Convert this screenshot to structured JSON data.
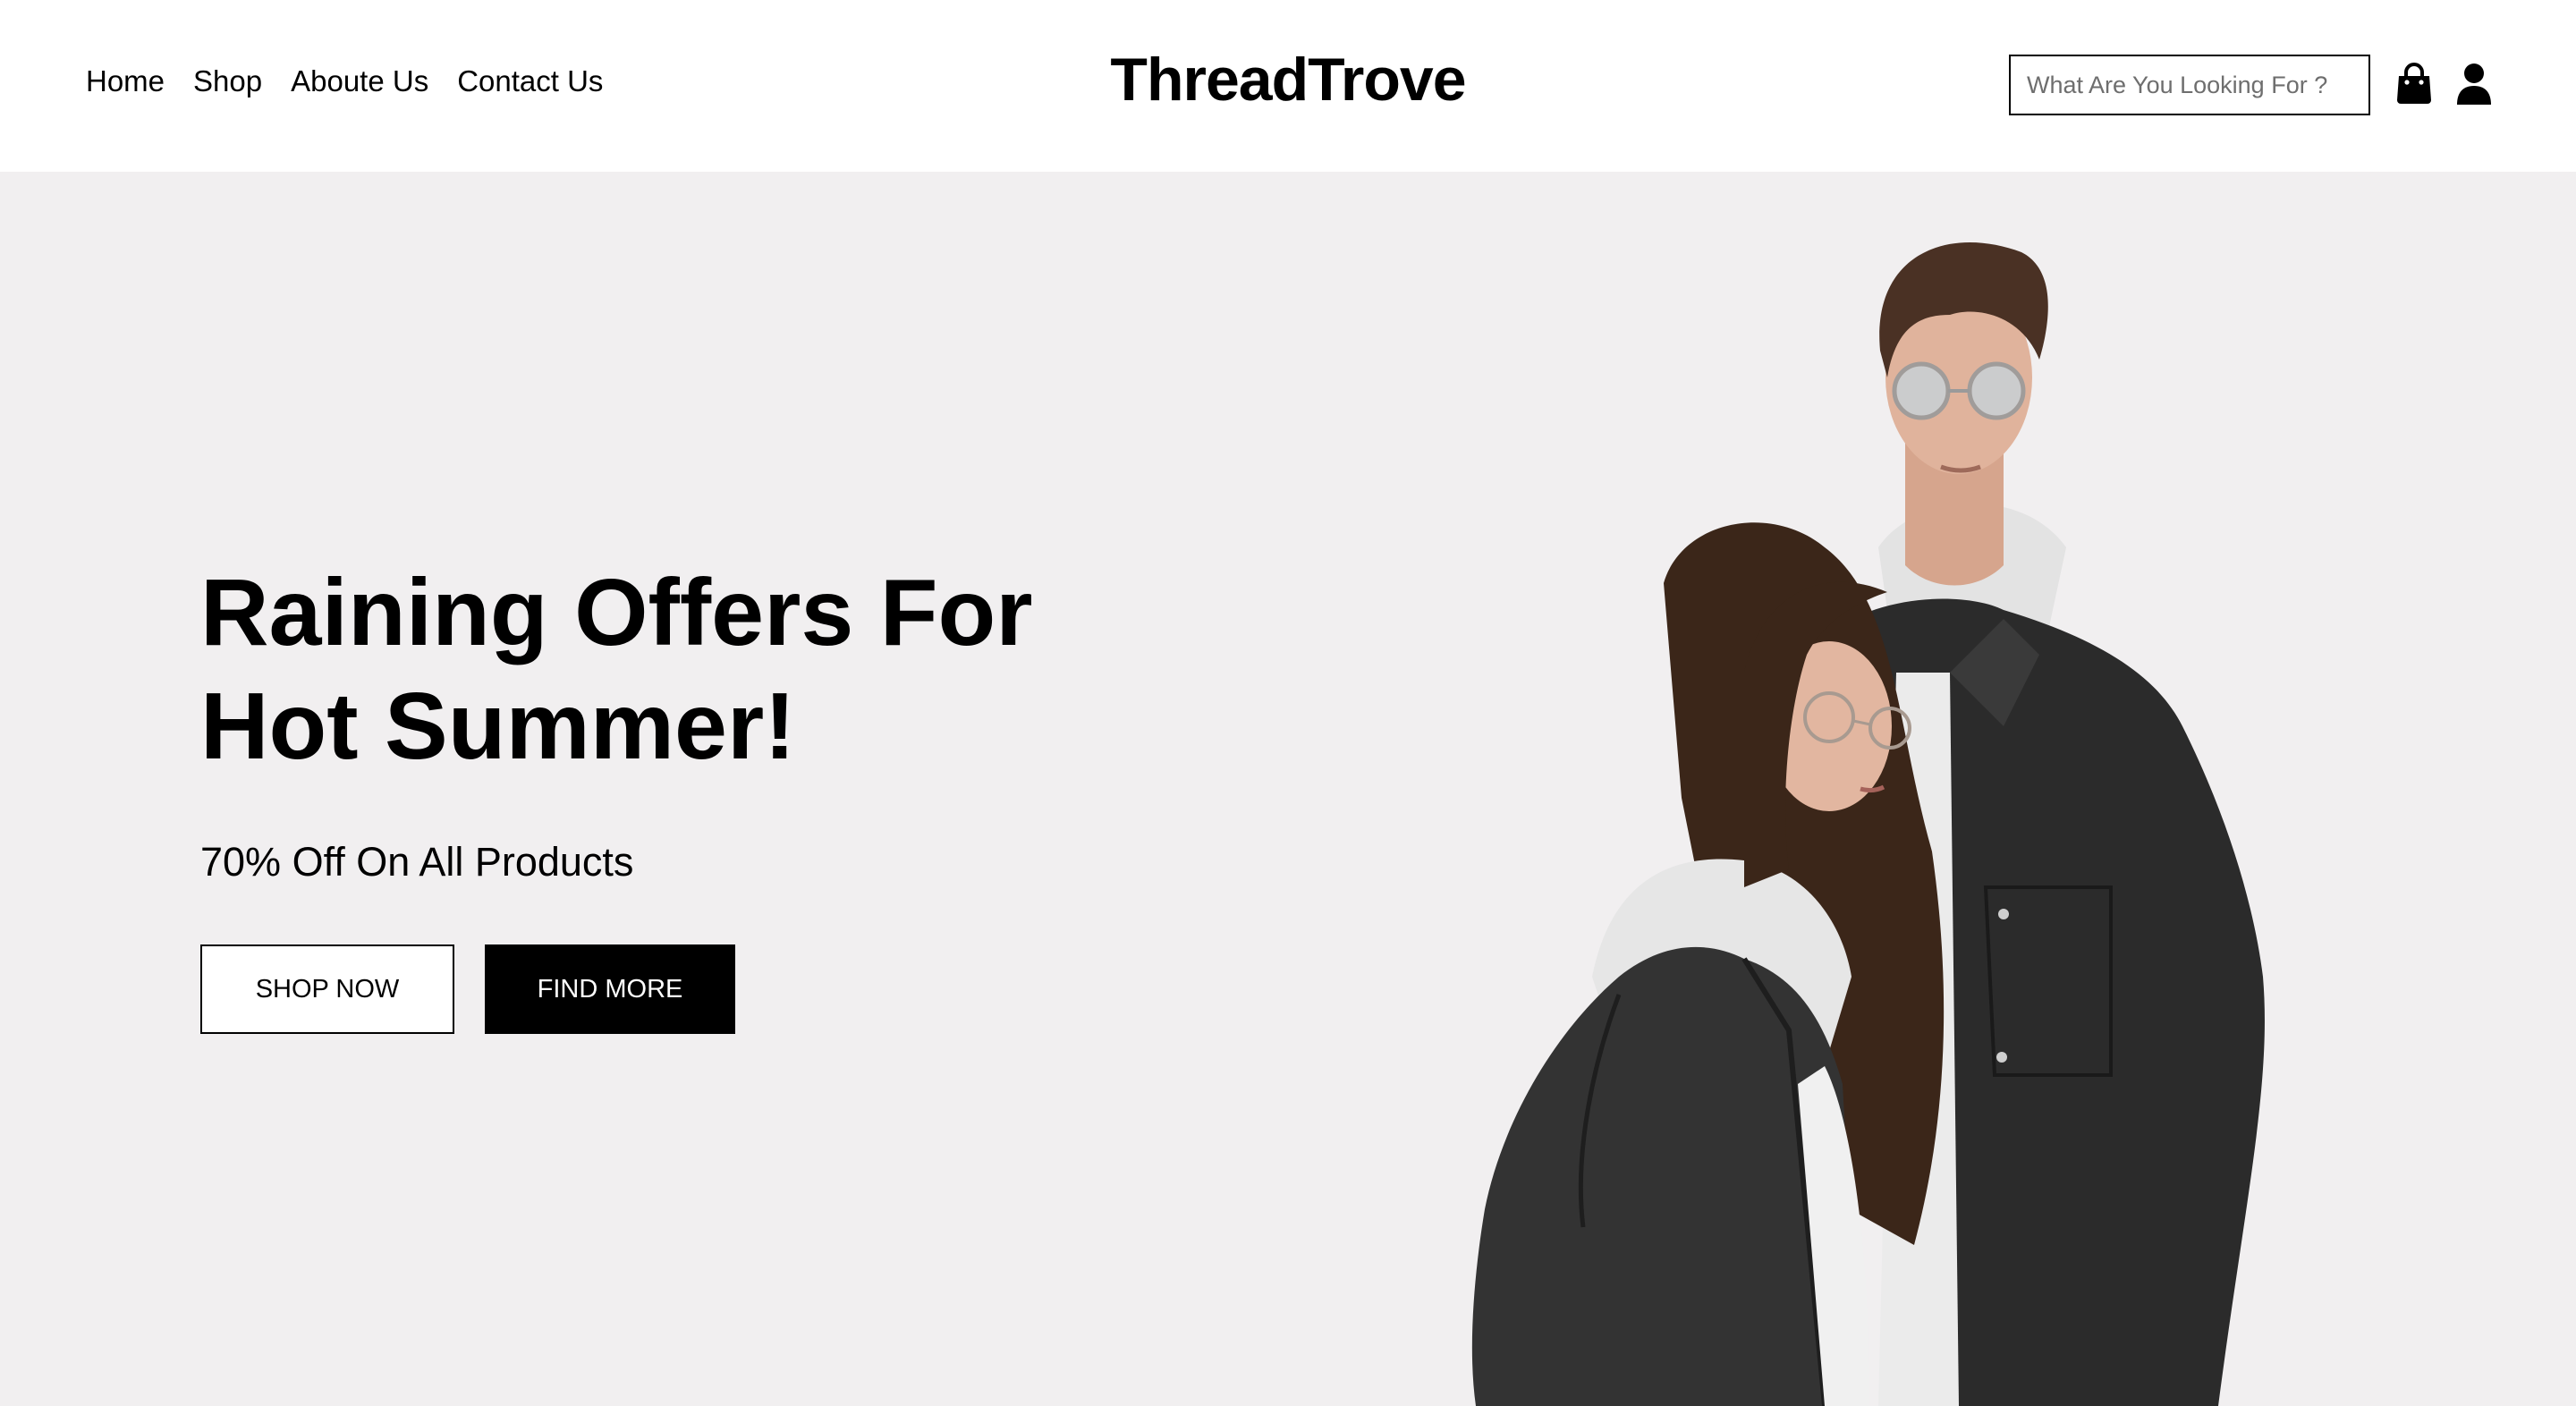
{
  "nav": {
    "items": [
      {
        "label": "Home"
      },
      {
        "label": "Shop"
      },
      {
        "label": "Aboute Us"
      },
      {
        "label": "Contact Us"
      }
    ]
  },
  "brand": {
    "logo_text": "ThreadTrove"
  },
  "search": {
    "placeholder": "What Are You Looking For ?",
    "value": ""
  },
  "icons": {
    "cart": "shopping-bag-icon",
    "account": "user-icon"
  },
  "hero": {
    "headline_line1": "Raining Offers For",
    "headline_line2": "Hot Summer!",
    "subheadline": "70% Off On All Products",
    "primary_button": "SHOP NOW",
    "secondary_button": "FIND MORE",
    "image_description": "couple-in-denim-jackets-photo"
  },
  "colors": {
    "hero_background": "#f1eff0",
    "accent": "#000000",
    "header_background": "#ffffff"
  }
}
